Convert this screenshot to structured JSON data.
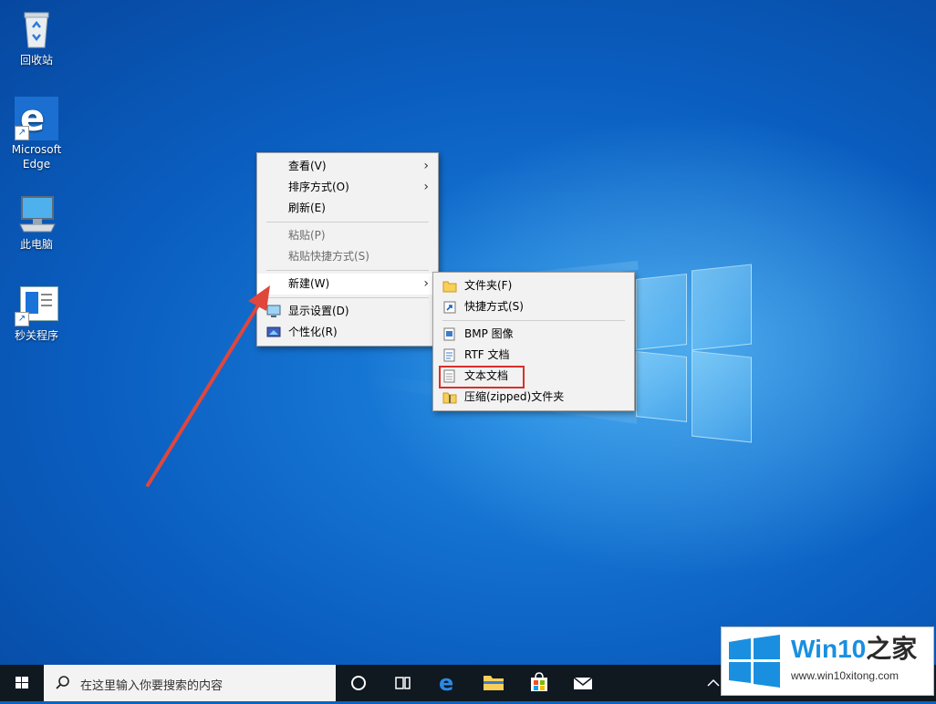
{
  "desktop_icons": [
    {
      "label": "回收站",
      "icon": "recycle-bin-icon"
    },
    {
      "label": "Microsoft Edge",
      "icon": "edge-icon"
    },
    {
      "label": "此电脑",
      "icon": "this-pc-icon"
    },
    {
      "label": "秒关程序",
      "icon": "program-shortcut-icon"
    }
  ],
  "context_menu": {
    "view": "查看(V)",
    "sort": "排序方式(O)",
    "refresh": "刷新(E)",
    "paste": "粘贴(P)",
    "paste_shortcut": "粘贴快捷方式(S)",
    "new": "新建(W)",
    "display": "显示设置(D)",
    "personalize": "个性化(R)"
  },
  "new_submenu": {
    "folder": "文件夹(F)",
    "shortcut": "快捷方式(S)",
    "bmp": "BMP 图像",
    "rtf": "RTF 文档",
    "text": "文本文档",
    "zip": "压缩(zipped)文件夹"
  },
  "taskbar": {
    "search_placeholder": "在这里输入你要搜索的内容"
  },
  "watermark": {
    "brand": "Win10",
    "brand_suffix": "之家",
    "url": "www.win10xitong.com"
  },
  "colors": {
    "highlight_box": "#d9302a",
    "annotation_arrow": "#e0463c",
    "taskbar": "#101820"
  }
}
